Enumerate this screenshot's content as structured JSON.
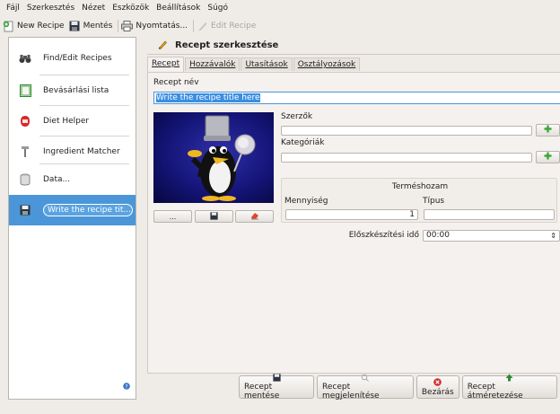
{
  "menubar": {
    "items": [
      {
        "label": "Fájl",
        "key": "F"
      },
      {
        "label": "Szerkesztés",
        "key": "z"
      },
      {
        "label": "Nézet",
        "key": "N"
      },
      {
        "label": "Eszközök",
        "key": "E"
      },
      {
        "label": "Beállítások",
        "key": "B"
      },
      {
        "label": "Súgó",
        "key": "S"
      }
    ]
  },
  "toolbar": {
    "new_recipe": "New Recipe",
    "save": "Mentés",
    "print": "Nyomtatás...",
    "edit_recipe": "Edit Recipe"
  },
  "sidebar": {
    "items": [
      {
        "label": "Find/Edit Recipes",
        "icon": "binoculars-icon"
      },
      {
        "label": "Bevásárlási lista",
        "icon": "shopping-list-icon"
      },
      {
        "label": "Diet Helper",
        "icon": "diet-helper-icon"
      },
      {
        "label": "Ingredient Matcher",
        "icon": "ingredient-matcher-icon"
      },
      {
        "label": "Data...",
        "icon": "database-icon"
      },
      {
        "label": "Write the recipe tit...",
        "icon": "floppy-icon"
      }
    ]
  },
  "editor": {
    "title": "Recept szerkesztése",
    "tabs": [
      "Recept",
      "Hozzávalók",
      "Utasítások",
      "Osztályozások"
    ],
    "recipe_name_label": "Recept név",
    "recipe_name_value": "Write the recipe title here",
    "photo_buttons": {
      "browse": "..."
    },
    "authors_label": "Szerzők",
    "categories_label": "Kategóriák",
    "yield_label": "Terméshozam",
    "quantity_label": "Mennyiség",
    "quantity_value": "1",
    "type_label": "Típus",
    "type_value": "",
    "prep_time_label": "Előszkészítési idő",
    "prep_time_value": "00:00"
  },
  "bottom_buttons": {
    "save": "Recept mentése",
    "show": "Recept megjelenítése",
    "close": "Bezárás",
    "resize": "Recept átméretezése"
  },
  "colors": {
    "selection": "#4b96d8",
    "add_green": "#3aa63a",
    "close_red": "#d42a2a"
  }
}
